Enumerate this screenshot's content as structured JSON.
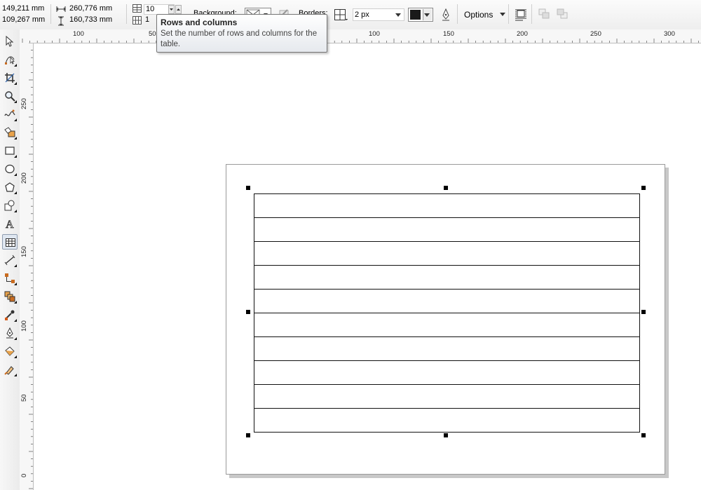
{
  "property_bar": {
    "position": {
      "x": "149,211 mm",
      "y": "109,267 mm"
    },
    "size": {
      "width": "260,776 mm",
      "height": "160,733 mm"
    },
    "rows": "10",
    "columns": "1",
    "background_label": "Background:",
    "borders_label": "Borders:",
    "border_width": "2 px",
    "border_color": "#1a1a1a",
    "options_label": "Options"
  },
  "tooltip": {
    "title": "Rows and columns",
    "body": "Set the number of rows and columns for the table."
  },
  "toolbox": {
    "tools": [
      "pick-tool",
      "shape-tool",
      "crop-tool",
      "zoom-tool",
      "freehand-tool",
      "smart-fill-tool",
      "rectangle-tool",
      "ellipse-tool",
      "polygon-tool",
      "basic-shapes-tool",
      "text-tool",
      "table-tool",
      "dimension-tool",
      "connector-tool",
      "interactive-effects-tool",
      "eyedropper-tool",
      "outline-tool",
      "fill-tool",
      "interactive-fill-tool"
    ],
    "active": "table-tool"
  },
  "rulers": {
    "horizontal": [
      "100",
      "50",
      "100",
      "150",
      "200",
      "250",
      "300"
    ],
    "vertical": [
      "250",
      "200",
      "150",
      "100",
      "50",
      "0"
    ]
  },
  "table": {
    "rows": 10,
    "columns": 1
  }
}
